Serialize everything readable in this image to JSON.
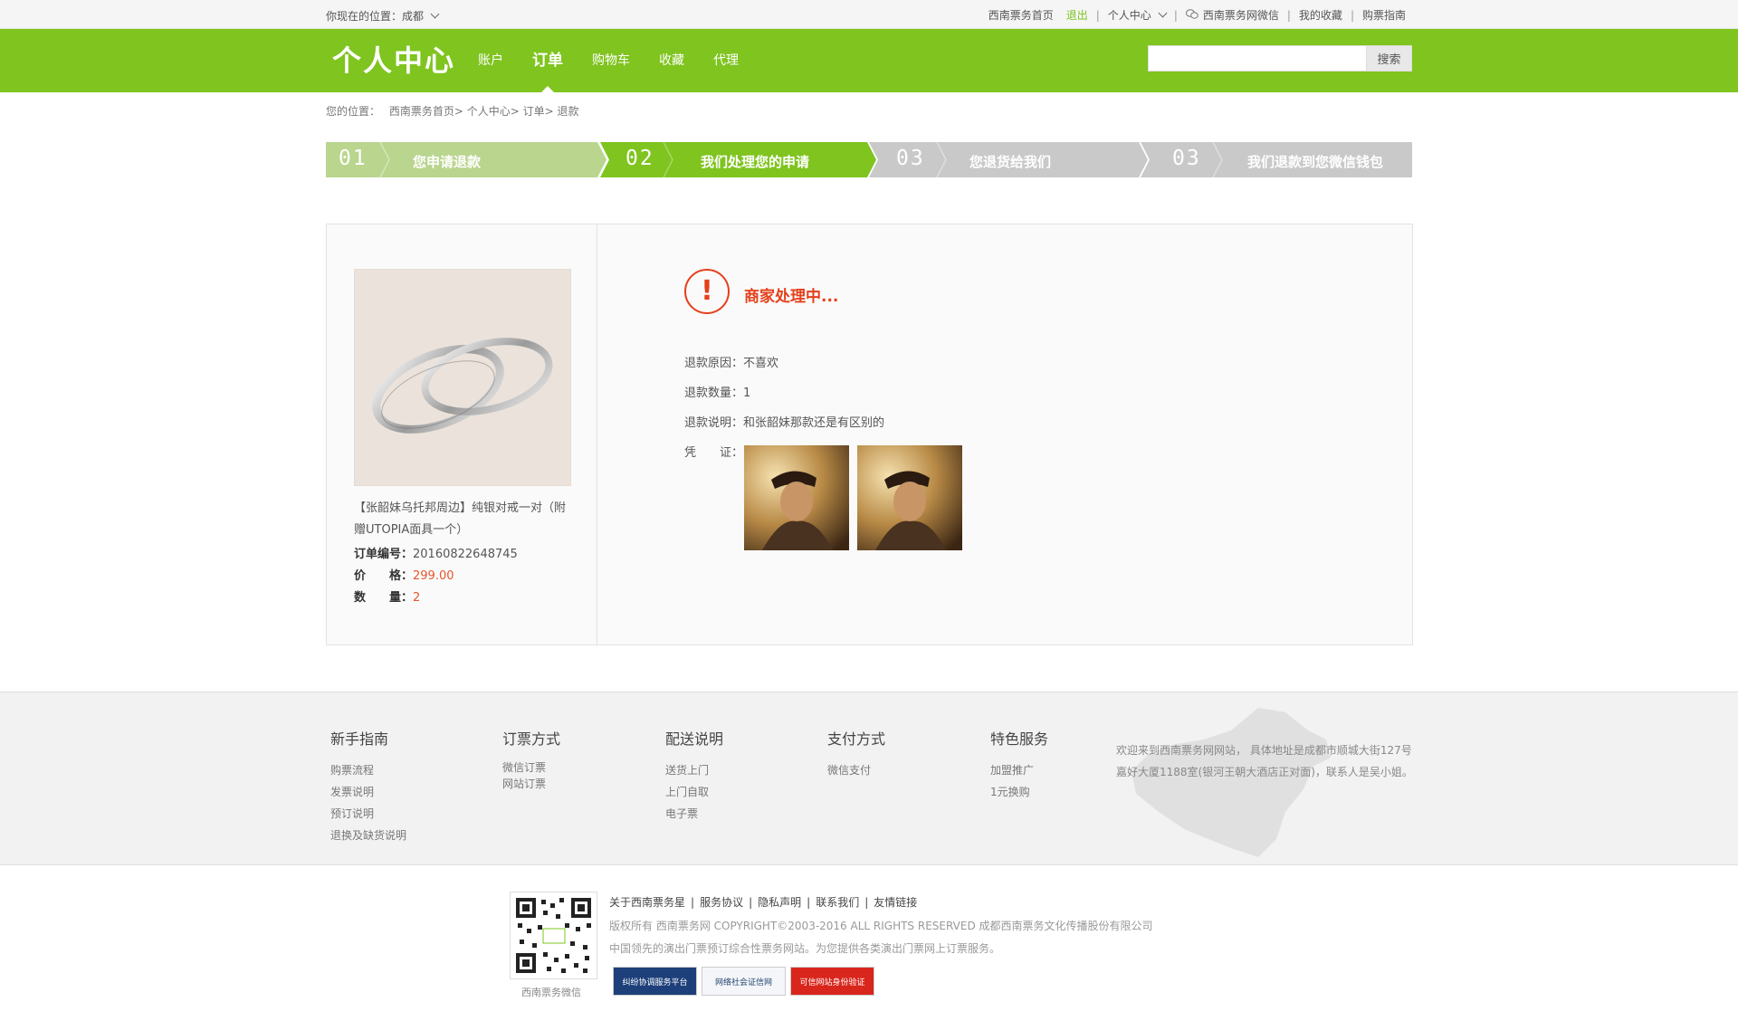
{
  "topbar": {
    "location": "你现在的位置：成都",
    "links": [
      "西南票务首页",
      "退出",
      "个人中心",
      "西南票务网微信",
      "我的收藏",
      "购票指南"
    ]
  },
  "header": {
    "logo": "个人中心",
    "nav": [
      "账户",
      "订单",
      "购物车",
      "收藏",
      "代理"
    ],
    "active_nav": "订单",
    "search_placeholder": "",
    "search_button": "搜索"
  },
  "breadcrumb": {
    "prefix": "您的位置：",
    "items": [
      "西南票务首页",
      "个人中心",
      "订单",
      "退款"
    ]
  },
  "steps": [
    {
      "num": "01",
      "label": "您申请退款",
      "state": "done"
    },
    {
      "num": "02",
      "label": "我们处理您的申请",
      "state": "current"
    },
    {
      "num": "03",
      "label": "您退货给我们",
      "state": "todo"
    },
    {
      "num": "03",
      "label": "我们退款到您微信钱包",
      "state": "todo"
    }
  ],
  "product": {
    "title": "【张韶妹乌托邦周边】纯银对戒一对（附赠UTOPIA面具一个）",
    "order_label": "订单编号：",
    "order_no": "20160822648745",
    "price_label": "价　　格：",
    "price": "299.00",
    "qty_label": "数　　量：",
    "qty": "2"
  },
  "refund": {
    "status": "商家处理中...",
    "reason": "退款原因：不喜欢",
    "count": "退款数量：1",
    "desc": "退款说明：和张韶妹那款还是有区别的",
    "proof_label": "凭　　证："
  },
  "footer": {
    "columns": [
      {
        "title": "新手指南",
        "links": [
          "购票流程",
          "发票说明",
          "预订说明",
          "退换及缺货说明"
        ]
      },
      {
        "title": "订票方式",
        "links": [
          "微信订票",
          "网站订票"
        ]
      },
      {
        "title": "配送说明",
        "links": [
          "送货上门",
          "上门自取",
          "电子票"
        ]
      },
      {
        "title": "支付方式",
        "links": [
          "微信支付"
        ]
      },
      {
        "title": "特色服务",
        "links": [
          "加盟推广",
          "1元换购"
        ]
      }
    ],
    "welcome": "欢迎来到西南票务网网站， 具体地址是成都市顺城大街127号嘉好大厦1188室(银河王朝大酒店正对面)，联系人是吴小姐。",
    "bottom_links": [
      "关于西南票务星",
      "服务协议",
      "隐私声明",
      "联系我们",
      "友情链接"
    ],
    "copyright": "版权所有 西南票务网 COPYRIGHT©2003-2016 ALL RIGHTS RESERVED 成都西南票务文化传播股份有限公司",
    "slogan": "中国领先的演出门票预订综合性票务网站。为您提供各类演出门票网上订票服务。",
    "qr_label": "西南票务微信",
    "badges": [
      "纠纷协调服务平台",
      "网络社会证信网",
      "可信网站身份验证"
    ]
  },
  "colors": {
    "brand_green": "#7fc41f",
    "alert_red": "#e5401b",
    "price_orange": "#e5572a"
  }
}
